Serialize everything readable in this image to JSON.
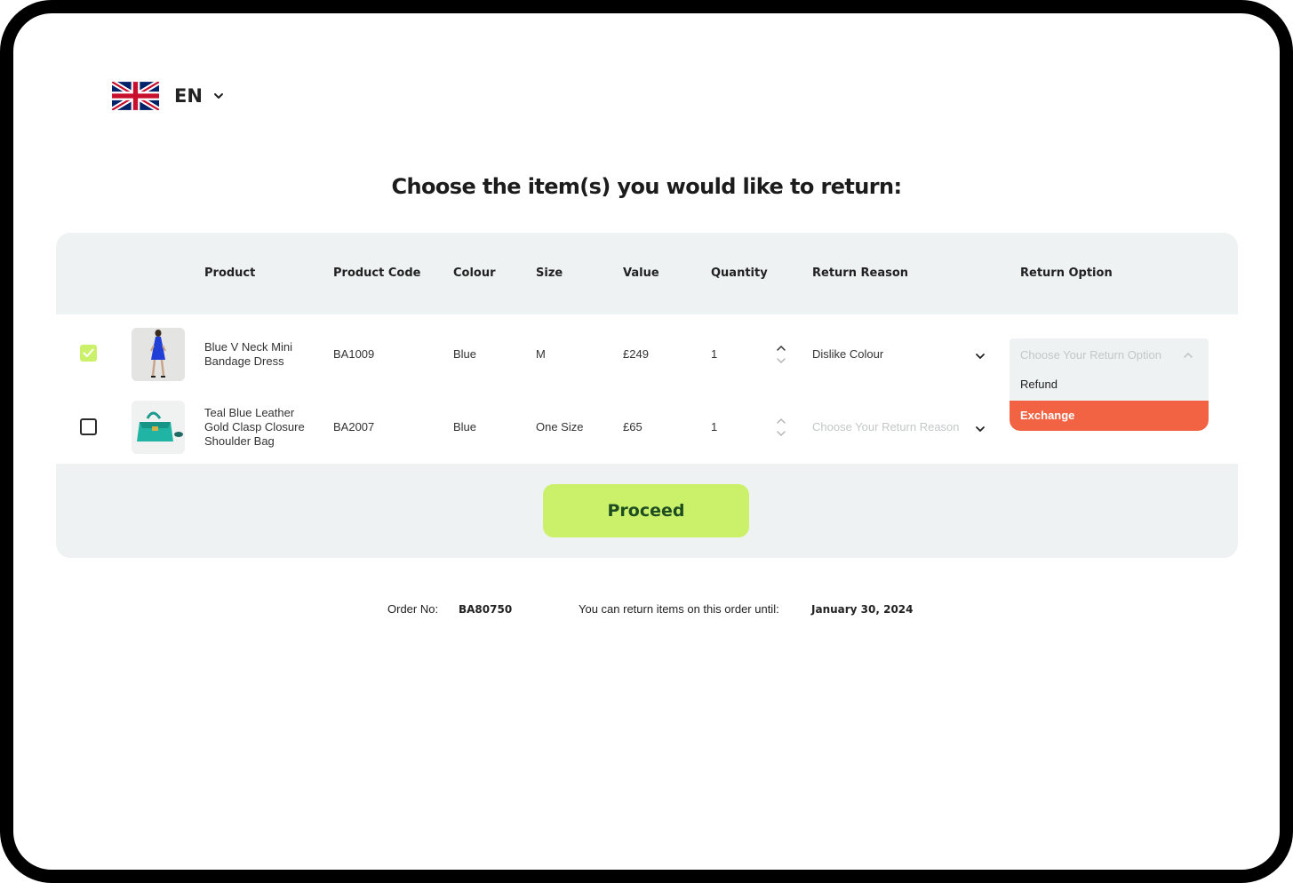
{
  "language": {
    "code": "EN",
    "flag_icon": "uk-flag-icon"
  },
  "heading": "Choose the item(s) you would like to return:",
  "table": {
    "headers": {
      "product": "Product",
      "product_code": "Product Code",
      "colour": "Colour",
      "size": "Size",
      "value": "Value",
      "quantity": "Quantity",
      "return_reason": "Return Reason",
      "return_option": "Return Option"
    },
    "rows": [
      {
        "selected": true,
        "product": "Blue V Neck Mini Bandage Dress",
        "product_code": "BA1009",
        "colour": "Blue",
        "size": "M",
        "value": "£249",
        "quantity": "1",
        "return_reason": "Dislike Colour"
      },
      {
        "selected": false,
        "product": "Teal Blue Leather Gold Clasp Closure Shoulder Bag",
        "product_code": "BA2007",
        "colour": "Blue",
        "size": "One Size",
        "value": "£65",
        "quantity": "1",
        "return_reason_placeholder": "Choose Your Return Reason"
      }
    ]
  },
  "return_option_dropdown": {
    "placeholder": "Choose Your Return Option",
    "options": [
      "Refund",
      "Exchange"
    ],
    "highlighted": "Exchange"
  },
  "proceed_label": "Proceed",
  "footer": {
    "order_label": "Order No:",
    "order_number": "BA80750",
    "return_until_label": "You can return items on this order until:",
    "return_until_date": "January 30, 2024"
  },
  "colors": {
    "accent_green": "#cbf06a",
    "highlight_orange": "#f26343",
    "panel_grey": "#eff2f2"
  }
}
